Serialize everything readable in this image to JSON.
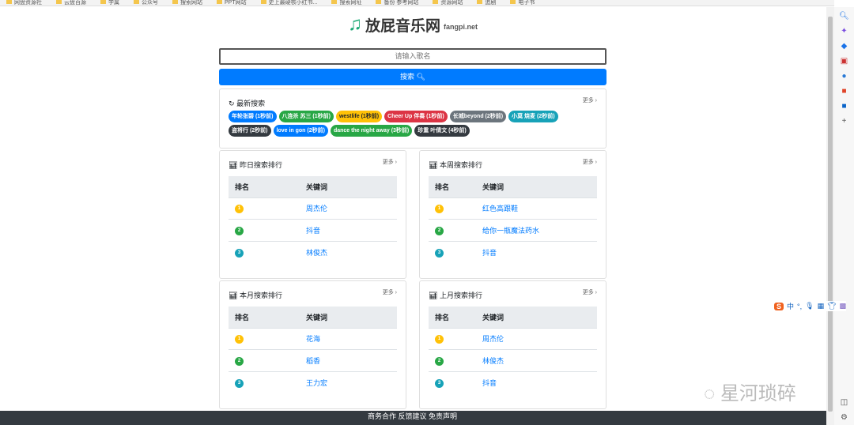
{
  "bookmarks": [
    "网盘资源社",
    "云盘百源",
    "学属",
    "公众号",
    "搜索网站",
    "PPT网站",
    "史上最硬核小红书...",
    "搜索网址",
    "备份 参考网站",
    "资源网站",
    "追剧",
    "电子书"
  ],
  "site": {
    "logo_icon": "music-note-icon",
    "name": "放屁音乐网",
    "domain": "fangpi.net"
  },
  "search": {
    "placeholder": "请输入歌名",
    "button": "搜索"
  },
  "recent": {
    "title": "最新搜索",
    "more": "更多 ›",
    "tags": [
      {
        "text": "年轮张碧 (1秒前)",
        "color": "#007bff"
      },
      {
        "text": "八连杀 苏三 (1秒前)",
        "color": "#28a745"
      },
      {
        "text": "westlife (1秒前)",
        "color": "#ffc107",
        "dark": true
      },
      {
        "text": "Cheer Up 伴奏 (1秒前)",
        "color": "#dc3545"
      },
      {
        "text": "长城beyond (2秒前)",
        "color": "#6c757d"
      },
      {
        "text": "小莫 烧麦 (2秒前)",
        "color": "#17a2b8"
      },
      {
        "text": "盗将行 (2秒前)",
        "color": "#343a40"
      },
      {
        "text": "love in gon (2秒前)",
        "color": "#007bff"
      },
      {
        "text": "dance the night away (3秒前)",
        "color": "#28a745"
      },
      {
        "text": "珍重 叶倩文 (4秒前)",
        "color": "#343a40"
      }
    ]
  },
  "rank_colors": [
    "#ffc107",
    "#28a745",
    "#17a2b8"
  ],
  "rankings": [
    {
      "title": "昨日搜索排行",
      "more": "更多 ›",
      "col_rank": "排名",
      "col_kw": "关键词",
      "rows": [
        {
          "n": "1",
          "kw": "周杰伦"
        },
        {
          "n": "2",
          "kw": "抖音"
        },
        {
          "n": "3",
          "kw": "林俊杰"
        }
      ]
    },
    {
      "title": "本周搜索排行",
      "more": "更多 ›",
      "col_rank": "排名",
      "col_kw": "关键词",
      "rows": [
        {
          "n": "1",
          "kw": "红色高跟鞋"
        },
        {
          "n": "2",
          "kw": "给你一瓶魔法药水"
        },
        {
          "n": "3",
          "kw": "抖音"
        }
      ]
    },
    {
      "title": "本月搜索排行",
      "more": "更多 ›",
      "col_rank": "排名",
      "col_kw": "关键词",
      "rows": [
        {
          "n": "1",
          "kw": "花海"
        },
        {
          "n": "2",
          "kw": "稻香"
        },
        {
          "n": "3",
          "kw": "王力宏"
        }
      ]
    },
    {
      "title": "上月搜索排行",
      "more": "更多 ›",
      "col_rank": "排名",
      "col_kw": "关键词",
      "rows": [
        {
          "n": "1",
          "kw": "周杰伦"
        },
        {
          "n": "2",
          "kw": "林俊杰"
        },
        {
          "n": "3",
          "kw": "抖音"
        }
      ]
    }
  ],
  "footer": "商务合作 反馈建议 免责声明",
  "ime": {
    "logo": "S",
    "mode": "中"
  },
  "watermark": "星河琐碎"
}
